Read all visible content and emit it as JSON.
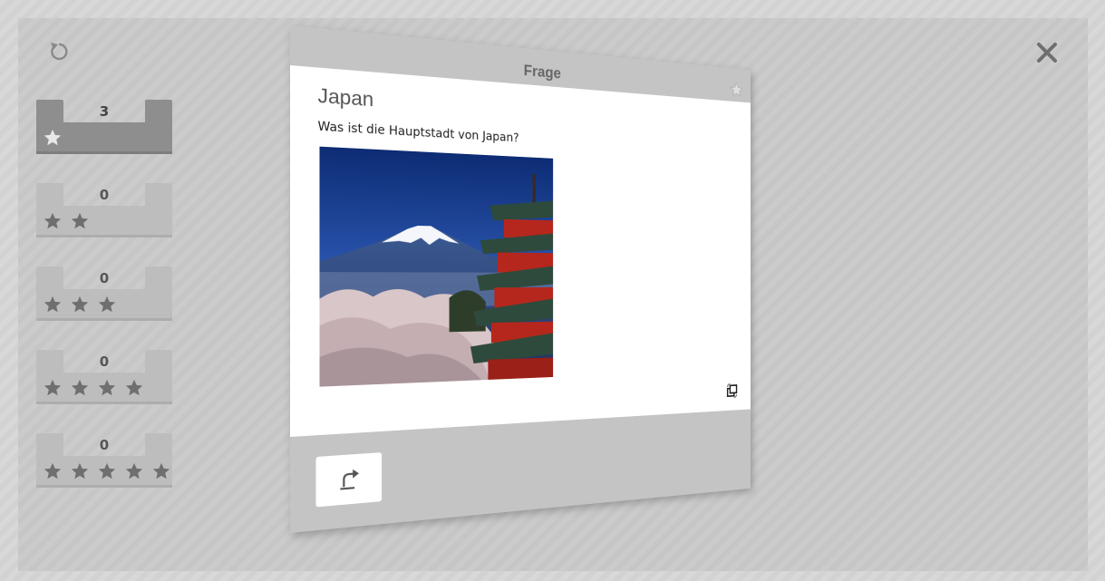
{
  "boxes": [
    {
      "count": "3",
      "stars": 1,
      "active": true
    },
    {
      "count": "0",
      "stars": 2,
      "active": false
    },
    {
      "count": "0",
      "stars": 3,
      "active": false
    },
    {
      "count": "0",
      "stars": 4,
      "active": false
    },
    {
      "count": "0",
      "stars": 5,
      "active": false
    }
  ],
  "card": {
    "header": "Frage",
    "title": "Japan",
    "question": "Was ist die Hauptstadt von Japan?"
  },
  "icons": {
    "reload": "reload-icon",
    "close": "close-icon",
    "star": "star-icon",
    "flip": "flip-card-icon",
    "back": "undo-icon"
  },
  "colors": {
    "box_active": "#8e8e8e",
    "box_inactive": "#bdbdbd",
    "star_dark": "#6f6f6f",
    "card_frame": "#c4c4c4",
    "card_body": "#ffffff"
  }
}
